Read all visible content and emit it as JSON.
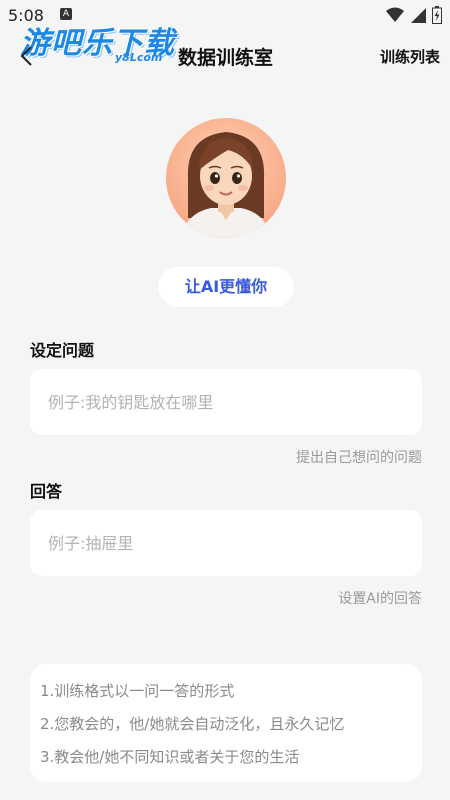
{
  "status_bar": {
    "time": "5:08",
    "notification_badge": "A"
  },
  "watermark": {
    "main": "游吧乐下载",
    "sub": "y8Lcom"
  },
  "header": {
    "title": "数据训练室",
    "list_link": "训练列表"
  },
  "ai_button": {
    "label": "让AI更懂你"
  },
  "question": {
    "label": "设定问题",
    "placeholder": "例子:我的钥匙放在哪里",
    "hint": "提出自己想问的问题"
  },
  "answer": {
    "label": "回答",
    "placeholder": "例子:抽屉里",
    "hint": "设置AI的回答"
  },
  "tips": [
    "1.训练格式以一问一答的形式",
    "2.您教会的，他/她就会自动泛化，且永久记忆",
    "3.教会他/她不同知识或者关于您的生活"
  ],
  "icons": [
    "back-icon",
    "wifi-icon",
    "signal-icon",
    "battery-icon",
    "avatar-girl"
  ]
}
